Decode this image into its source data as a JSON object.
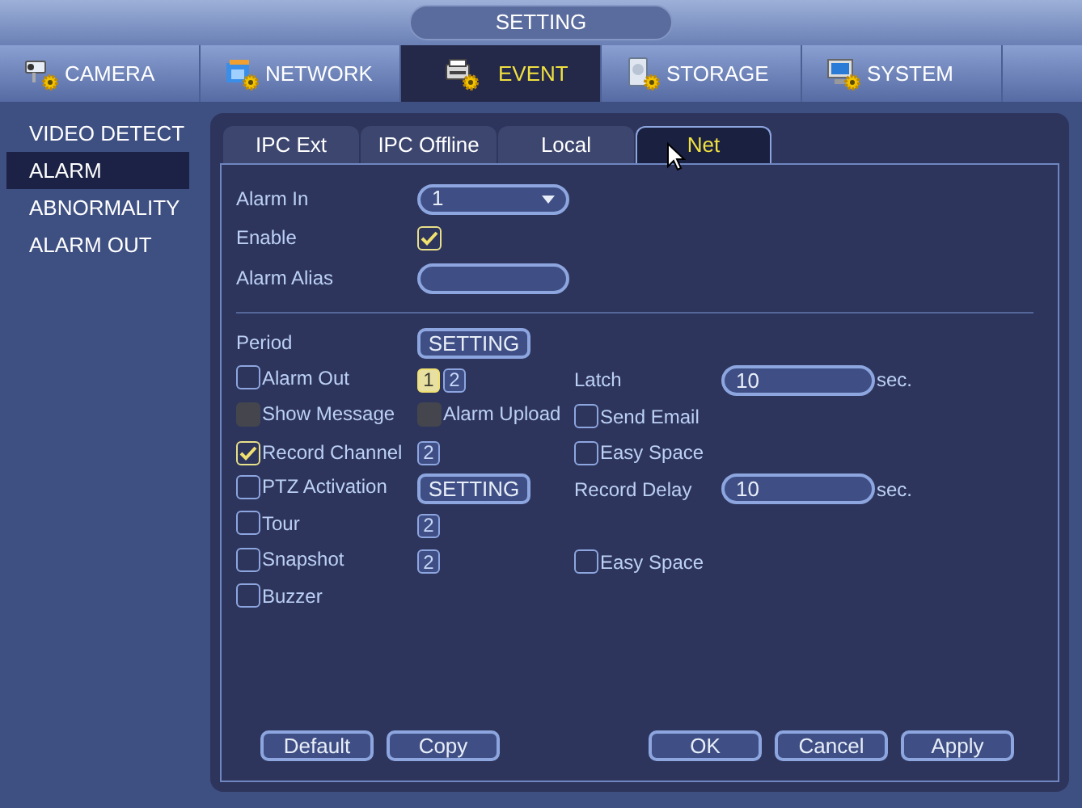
{
  "title": "SETTING",
  "main_tabs": [
    {
      "label": "CAMERA",
      "selected": false,
      "kind": "camera"
    },
    {
      "label": "NETWORK",
      "selected": false,
      "kind": "network"
    },
    {
      "label": "EVENT",
      "selected": true,
      "kind": "event"
    },
    {
      "label": "STORAGE",
      "selected": false,
      "kind": "storage"
    },
    {
      "label": "SYSTEM",
      "selected": false,
      "kind": "system"
    }
  ],
  "sidebar": [
    {
      "label": "VIDEO DETECT",
      "selected": false
    },
    {
      "label": "ALARM",
      "selected": true
    },
    {
      "label": "ABNORMALITY",
      "selected": false
    },
    {
      "label": "ALARM OUT",
      "selected": false
    }
  ],
  "sub_tabs": [
    {
      "label": "IPC Ext",
      "selected": false
    },
    {
      "label": "IPC Offline",
      "selected": false
    },
    {
      "label": "Local",
      "selected": false
    },
    {
      "label": "Net",
      "selected": true
    }
  ],
  "alarm_in": {
    "label": "Alarm In",
    "value": "1"
  },
  "enable": {
    "label": "Enable",
    "checked": true
  },
  "alarm_alias": {
    "label": "Alarm Alias"
  },
  "period": {
    "label": "Period",
    "button": "SETTING"
  },
  "rows": [
    [
      {
        "kind": "checkbox",
        "label": "Alarm Out",
        "checked": false,
        "disabled": false
      },
      {
        "kind": "channels",
        "items": [
          {
            "label": "1",
            "selected": true
          },
          {
            "label": "2",
            "selected": false
          }
        ]
      },
      {
        "kind": "field",
        "label": "Latch",
        "value": "10",
        "unit": "sec."
      }
    ],
    [
      {
        "kind": "checkbox",
        "label": "Show Message",
        "checked": false,
        "disabled": true
      },
      {
        "kind": "checkbox",
        "label": "Alarm Upload",
        "checked": false,
        "disabled": true
      },
      {
        "kind": "checkbox",
        "label": "Send Email",
        "checked": false,
        "disabled": false
      }
    ],
    [
      {
        "kind": "checkbox",
        "label": "Record Channel",
        "checked": true,
        "disabled": false
      },
      {
        "kind": "channels",
        "items": [
          {
            "label": "2",
            "selected": false
          }
        ]
      },
      {
        "kind": "checkbox",
        "label": "Easy Space",
        "checked": false,
        "disabled": false
      }
    ],
    [
      {
        "kind": "checkbox",
        "label": "PTZ Activation",
        "checked": false,
        "disabled": false
      },
      {
        "kind": "button",
        "label": "SETTING"
      },
      {
        "kind": "field",
        "label": "Record Delay",
        "value": "10",
        "unit": "sec."
      }
    ],
    [
      {
        "kind": "checkbox",
        "label": "Tour",
        "checked": false,
        "disabled": false
      },
      {
        "kind": "channels",
        "items": [
          {
            "label": "2",
            "selected": false
          }
        ]
      }
    ],
    [
      {
        "kind": "checkbox",
        "label": "Snapshot",
        "checked": false,
        "disabled": false
      },
      {
        "kind": "channels",
        "items": [
          {
            "label": "2",
            "selected": false
          }
        ]
      },
      {
        "kind": "checkbox",
        "label": "Easy Space",
        "checked": false,
        "disabled": false
      }
    ],
    [
      {
        "kind": "checkbox",
        "label": "Buzzer",
        "checked": false,
        "disabled": false
      }
    ]
  ],
  "footer_left": [
    "Default",
    "Copy"
  ],
  "footer_right": [
    "OK",
    "Cancel",
    "Apply"
  ]
}
